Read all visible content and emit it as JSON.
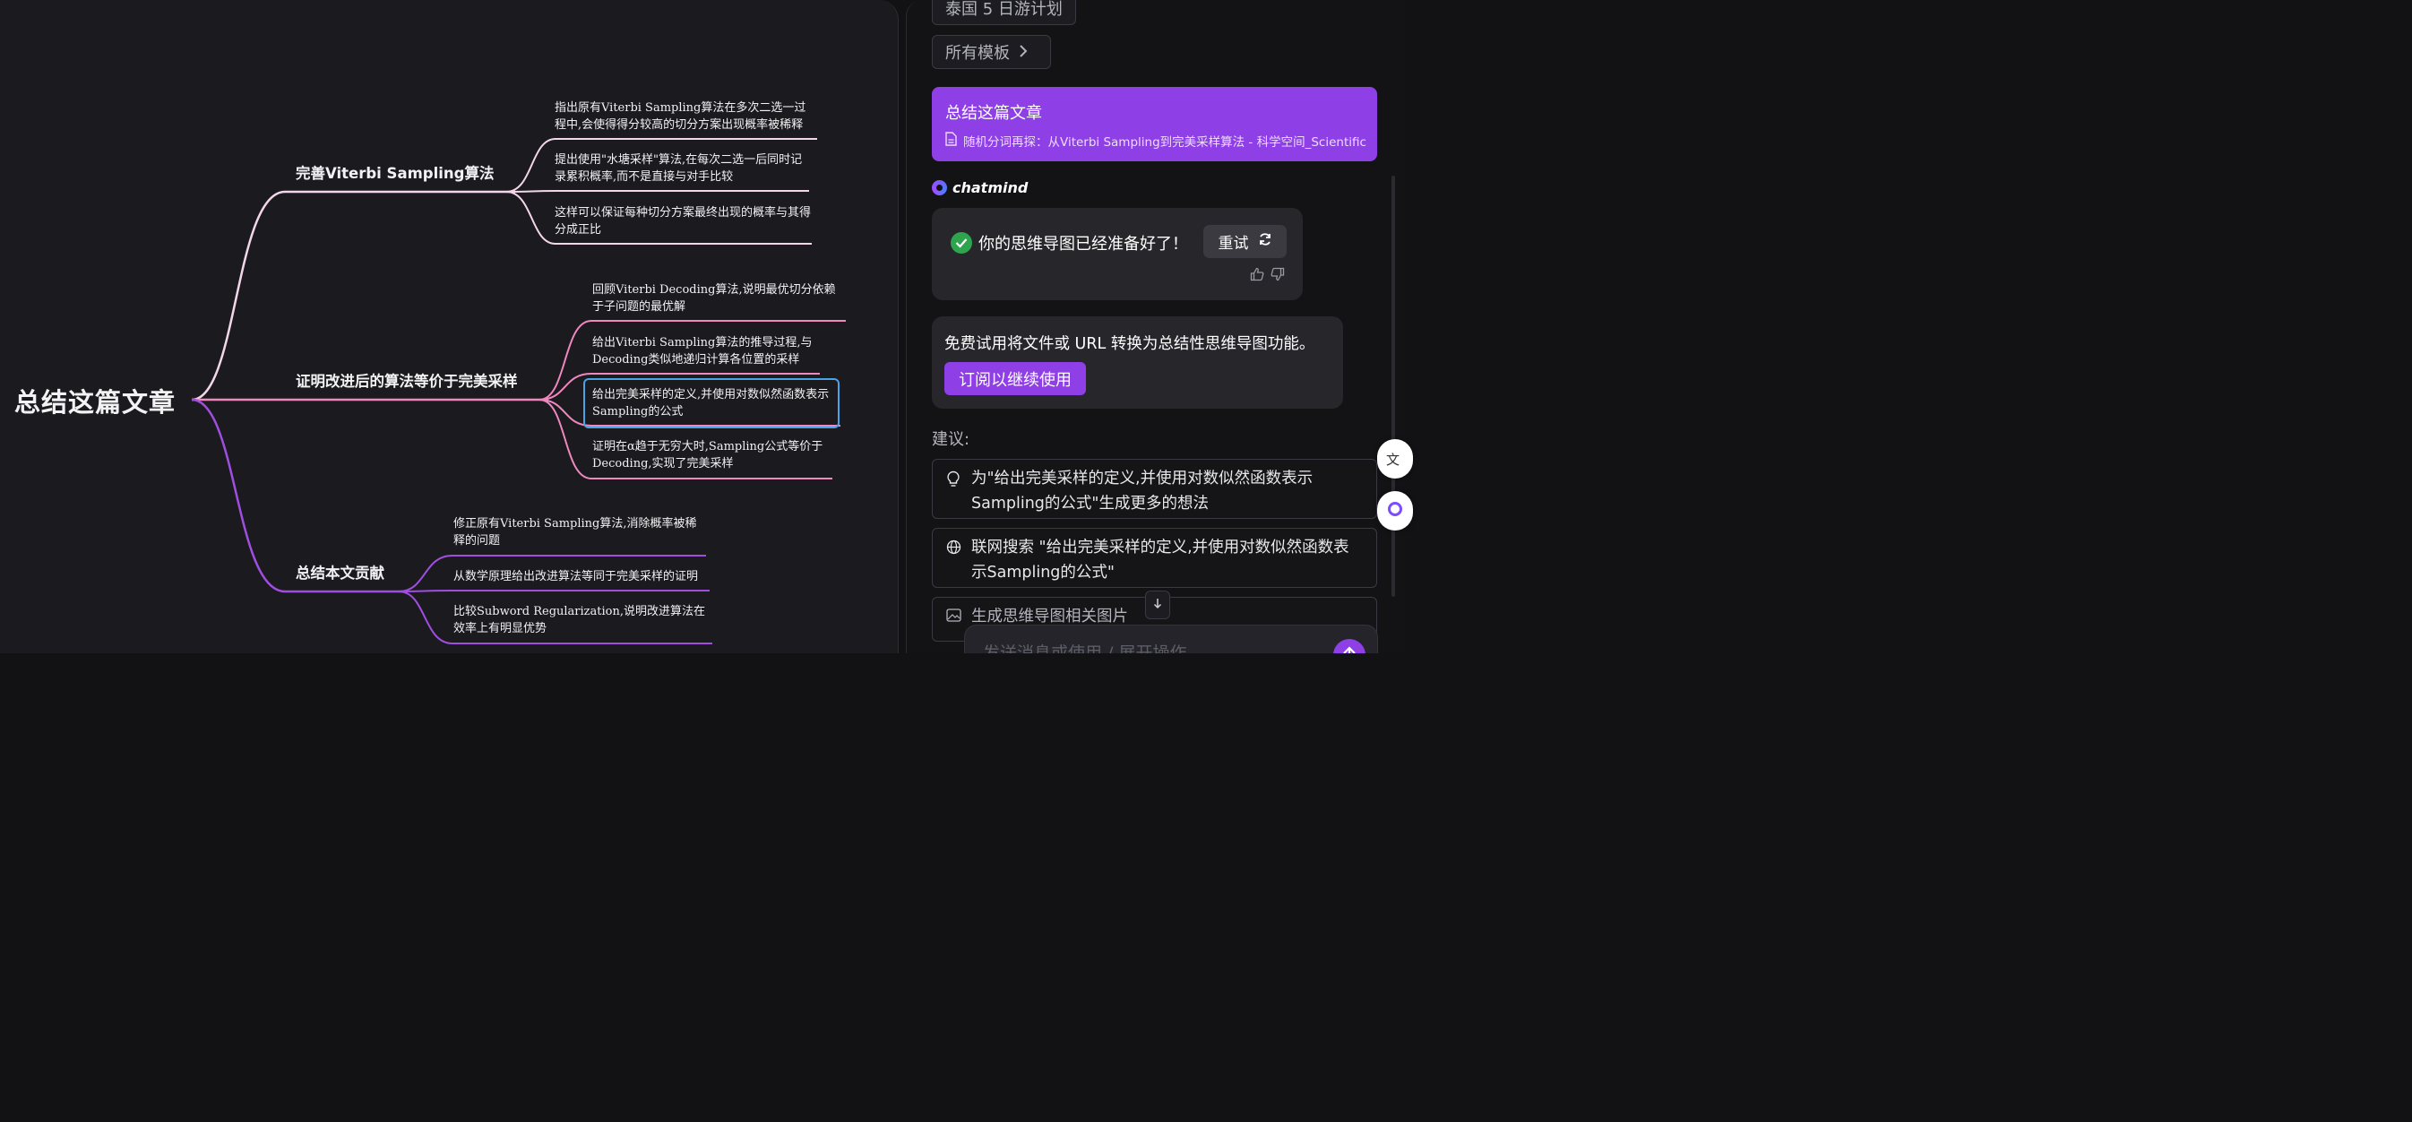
{
  "mindmap": {
    "root": "总结这篇文章",
    "branches": [
      {
        "label": "完善Viterbi Sampling算法",
        "color": "#f3d6ea",
        "leaves": [
          "指出原有Viterbi Sampling算法在多次二选一过程中,会使得得分较高的切分方案出现概率被稀释",
          "提出使用\"水塘采样\"算法,在每次二选一后同时记录累积概率,而不是直接与对手比较",
          "这样可以保证每种切分方案最终出现的概率与其得分成正比"
        ]
      },
      {
        "label": "证明改进后的算法等价于完美采样",
        "color": "#f088c0",
        "leaves": [
          "回顾Viterbi Decoding算法,说明最优切分依赖于子问题的最优解",
          "给出Viterbi Sampling算法的推导过程,与Decoding类似地递归计算各位置的采样",
          "给出完美采样的定义,并使用对数似然函数表示Sampling的公式",
          "证明在α趋于无穷大时,Sampling公式等价于Decoding,实现了完美采样"
        ]
      },
      {
        "label": "总结本文贡献",
        "color": "#a04ee0",
        "leaves": [
          "修正原有Viterbi Sampling算法,消除概率被稀释的问题",
          "从数学原理给出改进算法等同于完美采样的证明",
          "比较Subword Regularization,说明改进算法在效率上有明显优势"
        ]
      }
    ]
  },
  "panel": {
    "template_chip": "泰国 5 日游计划",
    "all_templates": "所有模板",
    "user_message": {
      "title": "总结这篇文章",
      "source": "随机分词再探：从Viterbi Sampling到完美采样算法 - 科学空间_Scientific..."
    },
    "assistant_name": "chatmind",
    "ready_text": "你的思维导图已经准备好了！",
    "retry_label": "重试",
    "trial": {
      "text": "免费试用将文件或 URL 转换为总结性思维导图功能。",
      "subscribe_label": "订阅以继续使用"
    },
    "suggestions_label": "建议:",
    "suggestions": [
      "为\"给出完美采样的定义,并使用对数似然函数表示Sampling的公式\"生成更多的想法",
      "联网搜索 \"给出完美采样的定义,并使用对数似然函数表示Sampling的公式\"",
      "生成思维导图相关图片"
    ],
    "composer_placeholder": "发送消息或使用 / 展开操作",
    "accent_color": "#8f3fe6"
  }
}
